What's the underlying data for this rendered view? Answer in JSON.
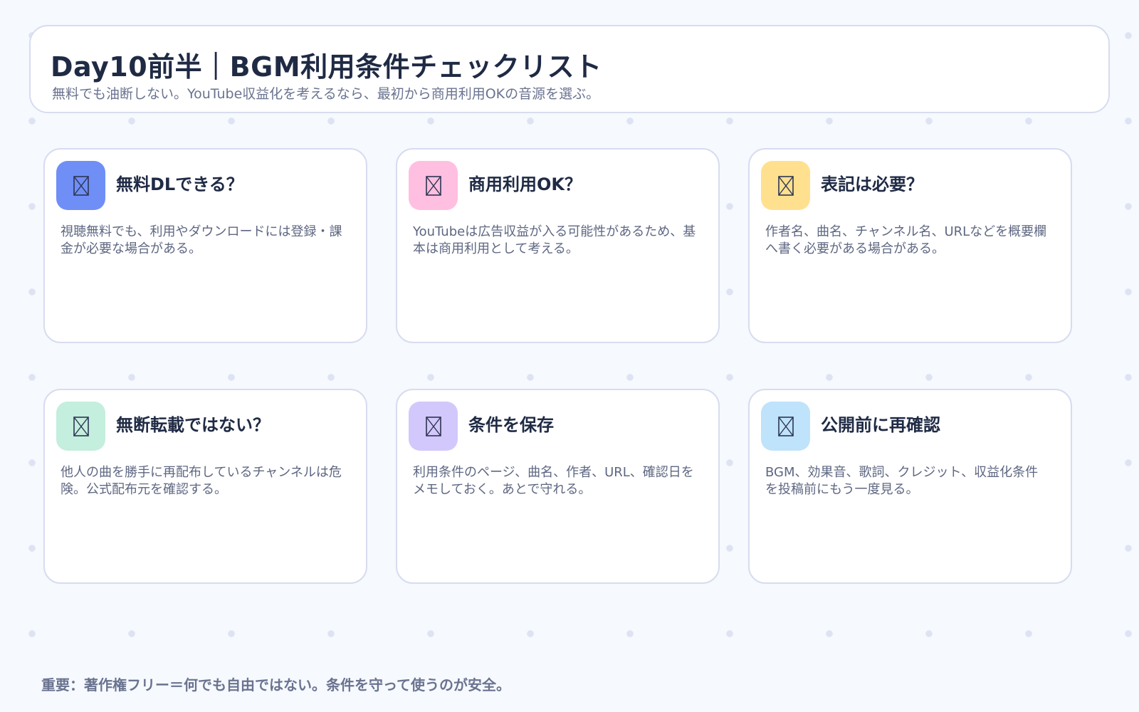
{
  "header": {
    "title": "Day10前半｜BGM利用条件チェックリスト",
    "subtitle": "無料でも油断しない。YouTube収益化を考えるなら、最初から商用利用OKの音源を選ぶ。"
  },
  "cards": [
    {
      "title": "無料DLできる？",
      "description": "視聴無料でも、利用やダウンロードには登録・課金が必要な場合がある。",
      "icon": "broken-image-icon",
      "color": "#6f8ff7"
    },
    {
      "title": "商用利用OK？",
      "description": "YouTubeは広告収益が入る可能性があるため、基本は商用利用として考える。",
      "icon": "broken-image-icon",
      "color": "#ffbfe0"
    },
    {
      "title": "表記は必要？",
      "description": "作者名、曲名、チャンネル名、URLなどを概要欄へ書く必要がある場合がある。",
      "icon": "broken-image-icon",
      "color": "#ffe08f"
    },
    {
      "title": "無断転載ではない？",
      "description": "他人の曲を勝手に再配布しているチャンネルは危険。公式配布元を確認する。",
      "icon": "broken-image-icon",
      "color": "#c4eedd"
    },
    {
      "title": "条件を保存",
      "description": "利用条件のページ、曲名、作者、URL、確認日をメモしておく。あとで守れる。",
      "icon": "broken-image-icon",
      "color": "#d3c8fb"
    },
    {
      "title": "公開前に再確認",
      "description": "BGM、効果音、歌詞、クレジット、収益化条件を投稿前にもう一度見る。",
      "icon": "broken-image-icon",
      "color": "#bfe3fb"
    }
  ],
  "footer": {
    "note": "重要：著作権フリー＝何でも自由ではない。条件を守って使うのが安全。"
  }
}
